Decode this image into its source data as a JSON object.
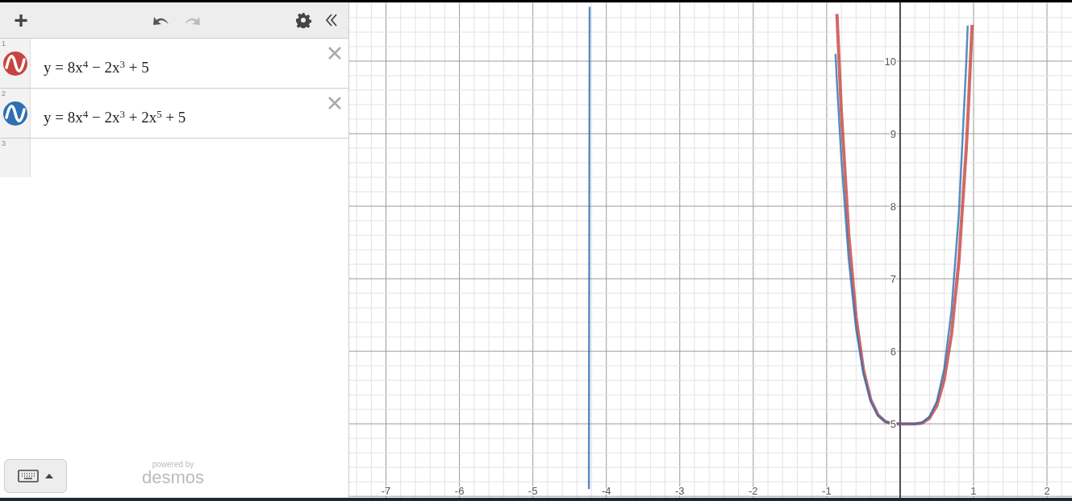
{
  "toolbar": {
    "add": "+"
  },
  "expressions": [
    {
      "number": "1",
      "latex": "y = 8x$^{4}$ − 2x$^{3}$ + 5",
      "color": "#c74440"
    },
    {
      "number": "2",
      "latex": "y = 8x$^{4}$ − 2x$^{3}$ + 2x$^{5}$ + 5",
      "color": "#2d70b3"
    },
    {
      "number": "3"
    }
  ],
  "footer": {
    "powered_by": "powered by",
    "brand": "desmos"
  },
  "graph": {
    "chart_data": {
      "type": "line",
      "grid": true,
      "x": [
        -4.2373,
        -4.235,
        -4.23,
        -4.2276,
        -0.88,
        -0.86,
        -0.8,
        -0.7,
        -0.6,
        -0.5,
        -0.4,
        -0.3,
        -0.2,
        -0.1,
        0,
        0.1,
        0.2,
        0.3,
        0.4,
        0.5,
        0.6,
        0.7,
        0.8,
        0.9,
        0.92,
        0.98
      ],
      "series": [
        {
          "color": "#c74440",
          "values": [
            null,
            null,
            null,
            null,
            null,
            10.65,
            9.3,
            7.61,
            6.47,
            5.75,
            5.33,
            5.12,
            5.03,
            5.0,
            5,
            5.0,
            5.0,
            5.01,
            5.08,
            5.25,
            5.61,
            6.24,
            7.25,
            8.79,
            9.17,
            10.5
          ]
        },
        {
          "color": "#2d70b3",
          "values": [
            4.1,
            5.7,
            9.2,
            10.75,
            10.1,
            9.71,
            8.65,
            7.27,
            6.31,
            5.69,
            5.31,
            5.11,
            5.03,
            5.0,
            5,
            5.0,
            5.0,
            5.02,
            5.1,
            5.31,
            5.76,
            6.57,
            7.91,
            9.97,
            10.49,
            null
          ]
        }
      ],
      "xlim": [
        -7.5,
        2.34
      ],
      "ylim": [
        3.98,
        10.81
      ],
      "xticks": [
        -7,
        -6,
        -5,
        -4,
        -3,
        -2,
        -1,
        1,
        2
      ],
      "yticks": [
        5,
        6,
        7,
        8,
        9,
        10
      ]
    }
  }
}
